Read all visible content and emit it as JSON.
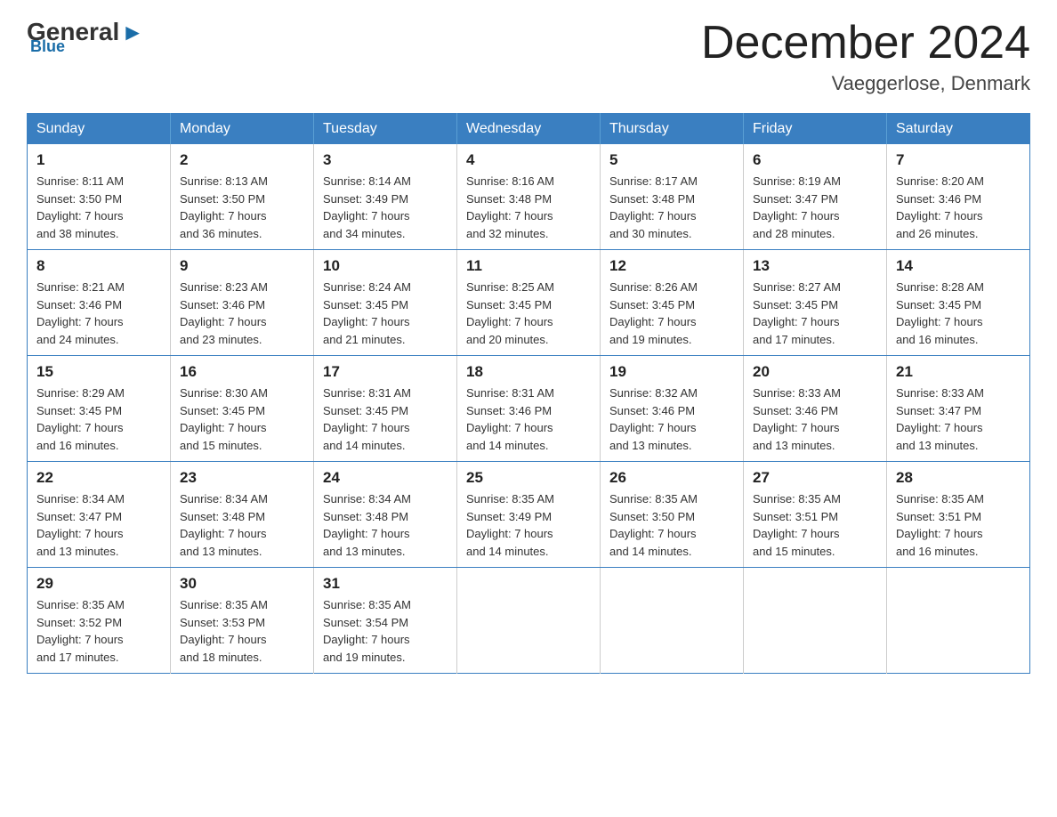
{
  "logo": {
    "general": "General",
    "blue": "Blue",
    "arrow": "▶"
  },
  "title": {
    "month_year": "December 2024",
    "location": "Vaeggerlose, Denmark"
  },
  "days_of_week": [
    "Sunday",
    "Monday",
    "Tuesday",
    "Wednesday",
    "Thursday",
    "Friday",
    "Saturday"
  ],
  "weeks": [
    [
      {
        "day": "1",
        "sunrise": "Sunrise: 8:11 AM",
        "sunset": "Sunset: 3:50 PM",
        "daylight": "Daylight: 7 hours",
        "minutes": "and 38 minutes."
      },
      {
        "day": "2",
        "sunrise": "Sunrise: 8:13 AM",
        "sunset": "Sunset: 3:50 PM",
        "daylight": "Daylight: 7 hours",
        "minutes": "and 36 minutes."
      },
      {
        "day": "3",
        "sunrise": "Sunrise: 8:14 AM",
        "sunset": "Sunset: 3:49 PM",
        "daylight": "Daylight: 7 hours",
        "minutes": "and 34 minutes."
      },
      {
        "day": "4",
        "sunrise": "Sunrise: 8:16 AM",
        "sunset": "Sunset: 3:48 PM",
        "daylight": "Daylight: 7 hours",
        "minutes": "and 32 minutes."
      },
      {
        "day": "5",
        "sunrise": "Sunrise: 8:17 AM",
        "sunset": "Sunset: 3:48 PM",
        "daylight": "Daylight: 7 hours",
        "minutes": "and 30 minutes."
      },
      {
        "day": "6",
        "sunrise": "Sunrise: 8:19 AM",
        "sunset": "Sunset: 3:47 PM",
        "daylight": "Daylight: 7 hours",
        "minutes": "and 28 minutes."
      },
      {
        "day": "7",
        "sunrise": "Sunrise: 8:20 AM",
        "sunset": "Sunset: 3:46 PM",
        "daylight": "Daylight: 7 hours",
        "minutes": "and 26 minutes."
      }
    ],
    [
      {
        "day": "8",
        "sunrise": "Sunrise: 8:21 AM",
        "sunset": "Sunset: 3:46 PM",
        "daylight": "Daylight: 7 hours",
        "minutes": "and 24 minutes."
      },
      {
        "day": "9",
        "sunrise": "Sunrise: 8:23 AM",
        "sunset": "Sunset: 3:46 PM",
        "daylight": "Daylight: 7 hours",
        "minutes": "and 23 minutes."
      },
      {
        "day": "10",
        "sunrise": "Sunrise: 8:24 AM",
        "sunset": "Sunset: 3:45 PM",
        "daylight": "Daylight: 7 hours",
        "minutes": "and 21 minutes."
      },
      {
        "day": "11",
        "sunrise": "Sunrise: 8:25 AM",
        "sunset": "Sunset: 3:45 PM",
        "daylight": "Daylight: 7 hours",
        "minutes": "and 20 minutes."
      },
      {
        "day": "12",
        "sunrise": "Sunrise: 8:26 AM",
        "sunset": "Sunset: 3:45 PM",
        "daylight": "Daylight: 7 hours",
        "minutes": "and 19 minutes."
      },
      {
        "day": "13",
        "sunrise": "Sunrise: 8:27 AM",
        "sunset": "Sunset: 3:45 PM",
        "daylight": "Daylight: 7 hours",
        "minutes": "and 17 minutes."
      },
      {
        "day": "14",
        "sunrise": "Sunrise: 8:28 AM",
        "sunset": "Sunset: 3:45 PM",
        "daylight": "Daylight: 7 hours",
        "minutes": "and 16 minutes."
      }
    ],
    [
      {
        "day": "15",
        "sunrise": "Sunrise: 8:29 AM",
        "sunset": "Sunset: 3:45 PM",
        "daylight": "Daylight: 7 hours",
        "minutes": "and 16 minutes."
      },
      {
        "day": "16",
        "sunrise": "Sunrise: 8:30 AM",
        "sunset": "Sunset: 3:45 PM",
        "daylight": "Daylight: 7 hours",
        "minutes": "and 15 minutes."
      },
      {
        "day": "17",
        "sunrise": "Sunrise: 8:31 AM",
        "sunset": "Sunset: 3:45 PM",
        "daylight": "Daylight: 7 hours",
        "minutes": "and 14 minutes."
      },
      {
        "day": "18",
        "sunrise": "Sunrise: 8:31 AM",
        "sunset": "Sunset: 3:46 PM",
        "daylight": "Daylight: 7 hours",
        "minutes": "and 14 minutes."
      },
      {
        "day": "19",
        "sunrise": "Sunrise: 8:32 AM",
        "sunset": "Sunset: 3:46 PM",
        "daylight": "Daylight: 7 hours",
        "minutes": "and 13 minutes."
      },
      {
        "day": "20",
        "sunrise": "Sunrise: 8:33 AM",
        "sunset": "Sunset: 3:46 PM",
        "daylight": "Daylight: 7 hours",
        "minutes": "and 13 minutes."
      },
      {
        "day": "21",
        "sunrise": "Sunrise: 8:33 AM",
        "sunset": "Sunset: 3:47 PM",
        "daylight": "Daylight: 7 hours",
        "minutes": "and 13 minutes."
      }
    ],
    [
      {
        "day": "22",
        "sunrise": "Sunrise: 8:34 AM",
        "sunset": "Sunset: 3:47 PM",
        "daylight": "Daylight: 7 hours",
        "minutes": "and 13 minutes."
      },
      {
        "day": "23",
        "sunrise": "Sunrise: 8:34 AM",
        "sunset": "Sunset: 3:48 PM",
        "daylight": "Daylight: 7 hours",
        "minutes": "and 13 minutes."
      },
      {
        "day": "24",
        "sunrise": "Sunrise: 8:34 AM",
        "sunset": "Sunset: 3:48 PM",
        "daylight": "Daylight: 7 hours",
        "minutes": "and 13 minutes."
      },
      {
        "day": "25",
        "sunrise": "Sunrise: 8:35 AM",
        "sunset": "Sunset: 3:49 PM",
        "daylight": "Daylight: 7 hours",
        "minutes": "and 14 minutes."
      },
      {
        "day": "26",
        "sunrise": "Sunrise: 8:35 AM",
        "sunset": "Sunset: 3:50 PM",
        "daylight": "Daylight: 7 hours",
        "minutes": "and 14 minutes."
      },
      {
        "day": "27",
        "sunrise": "Sunrise: 8:35 AM",
        "sunset": "Sunset: 3:51 PM",
        "daylight": "Daylight: 7 hours",
        "minutes": "and 15 minutes."
      },
      {
        "day": "28",
        "sunrise": "Sunrise: 8:35 AM",
        "sunset": "Sunset: 3:51 PM",
        "daylight": "Daylight: 7 hours",
        "minutes": "and 16 minutes."
      }
    ],
    [
      {
        "day": "29",
        "sunrise": "Sunrise: 8:35 AM",
        "sunset": "Sunset: 3:52 PM",
        "daylight": "Daylight: 7 hours",
        "minutes": "and 17 minutes."
      },
      {
        "day": "30",
        "sunrise": "Sunrise: 8:35 AM",
        "sunset": "Sunset: 3:53 PM",
        "daylight": "Daylight: 7 hours",
        "minutes": "and 18 minutes."
      },
      {
        "day": "31",
        "sunrise": "Sunrise: 8:35 AM",
        "sunset": "Sunset: 3:54 PM",
        "daylight": "Daylight: 7 hours",
        "minutes": "and 19 minutes."
      },
      null,
      null,
      null,
      null
    ]
  ]
}
